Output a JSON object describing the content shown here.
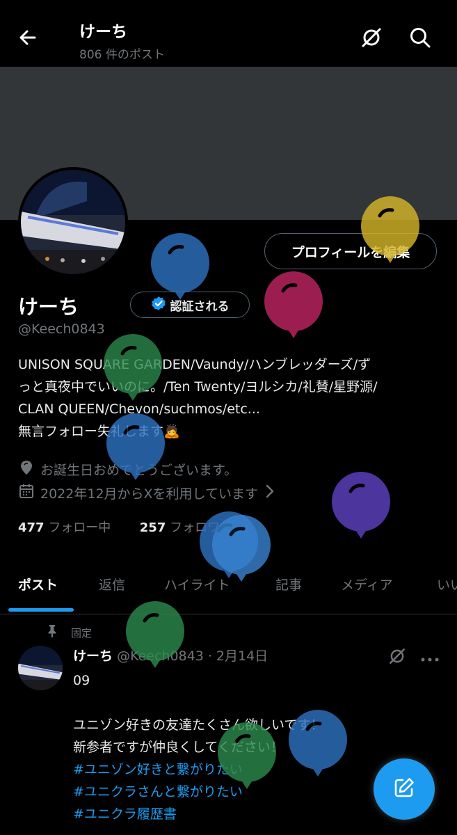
{
  "header": {
    "title": "けーち",
    "post_count": "806 件のポスト"
  },
  "profile": {
    "edit_label": "プロフィールを編集",
    "name": "けーち",
    "verify_label": "認証される",
    "handle": "@Keech0843",
    "bio_lines": [
      "UNISON SQUARE GARDEN/Vaundy/ハンブレッダーズ/ず",
      "っと真夜中でいいのに。/Ten Twenty/ヨルシカ/礼賛/星野源/",
      "CLAN QUEEN/Chevon/suchmos/etc...",
      "無言フォロー失礼します🙇"
    ],
    "birthday": "お誕生日おめでとうございます。",
    "joined": "2022年12月からXを利用しています",
    "following_count": "477",
    "following_label": "フォロー中",
    "followers_count": "257",
    "followers_label": "フォロワー"
  },
  "tabs": [
    {
      "label": "ポスト"
    },
    {
      "label": "返信"
    },
    {
      "label": "ハイライト"
    },
    {
      "label": "記事"
    },
    {
      "label": "メディア"
    },
    {
      "label": "いいね"
    }
  ],
  "post": {
    "pinned_label": "固定",
    "author": "けーち",
    "meta": "@Keech0843 · 2月14日",
    "lines": [
      "09",
      "",
      "ユニゾン好きの友達たくさん欲しいです！",
      "新参者ですが仲良くしてください！"
    ],
    "hashtags": [
      "#ユニゾン好きと繋がりたい",
      "#ユニクラさんと繋がりたい",
      "#ユニクラ履歴書"
    ]
  },
  "colors": {
    "accent": "#1d9bf0",
    "balloons": [
      "#d4b428",
      "#2f73c4",
      "#b8245e",
      "#2e8b4e",
      "#5a3fb8"
    ]
  },
  "icons": {
    "back": "arrow-left-icon",
    "grok": "grok-icon",
    "search": "search-icon",
    "verified": "verified-badge-icon",
    "location": "location-pin-icon",
    "calendar": "calendar-icon",
    "pin": "pin-icon",
    "compose": "compose-icon"
  }
}
